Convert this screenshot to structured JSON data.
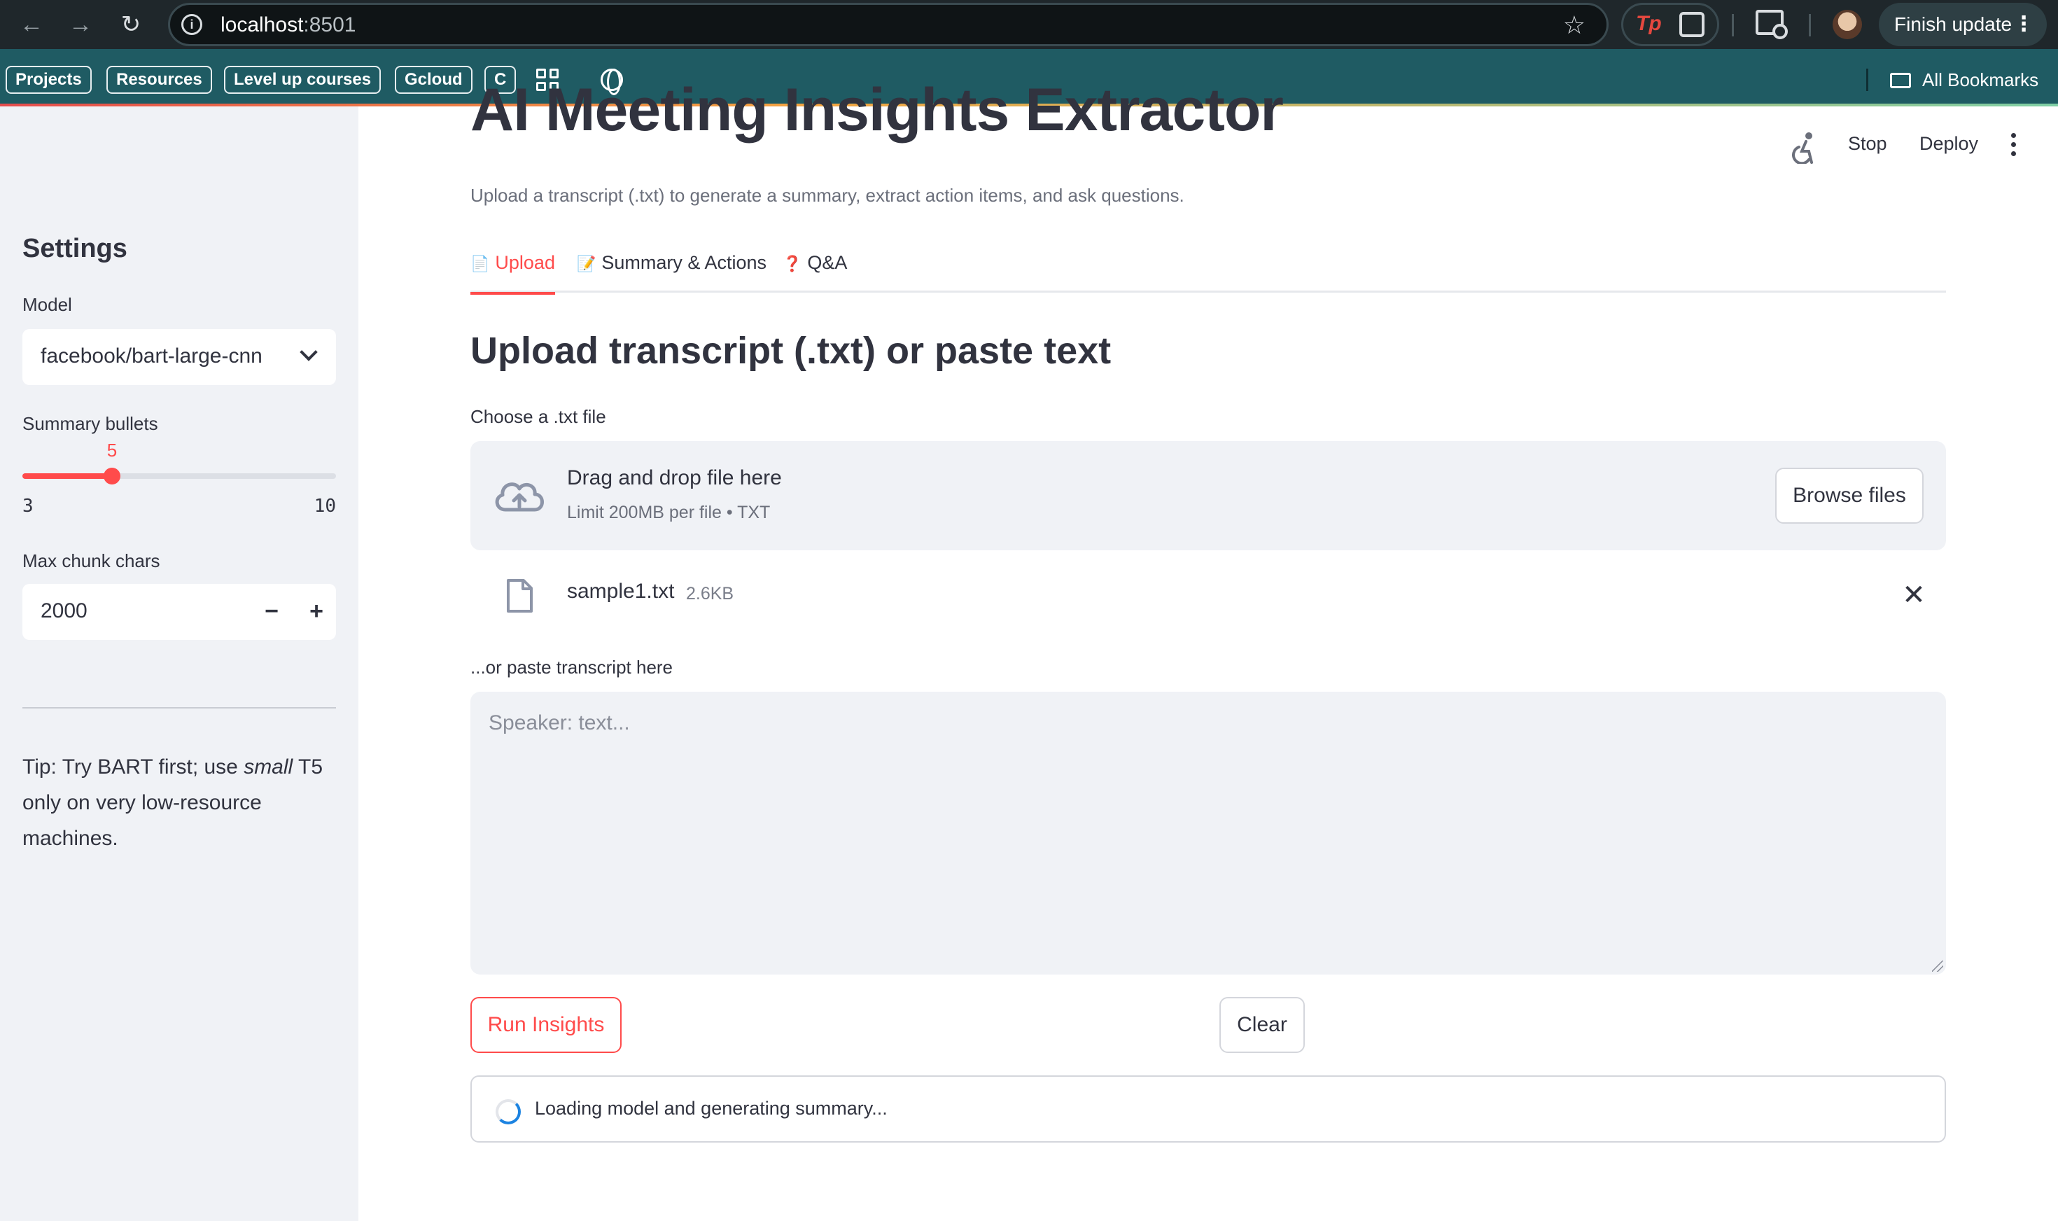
{
  "browser": {
    "url_host": "localhost",
    "url_port": ":8501",
    "finish_update": "Finish update",
    "bookmarks": [
      "Projects",
      "Resources",
      "Level up courses",
      "Gcloud",
      "C"
    ],
    "all_bookmarks": "All Bookmarks"
  },
  "app": {
    "title": "AI Meeting Insights Extractor",
    "subtitle": "Upload a transcript (.txt) to generate a summary, extract action items, and ask questions.",
    "stop_label": "Stop",
    "deploy_label": "Deploy"
  },
  "sidebar": {
    "title": "Settings",
    "model_label": "Model",
    "model_value": "facebook/bart-large-cnn",
    "bullets_label": "Summary bullets",
    "bullets_value": 5,
    "bullets_min": 3,
    "bullets_max": 10,
    "chunk_label": "Max chunk chars",
    "chunk_value": "2000",
    "tip_prefix": "Tip: Try BART first; use ",
    "tip_emphasis": "small",
    "tip_suffix": " T5 only on very low-resource machines."
  },
  "tabs": [
    {
      "icon": "📄",
      "label": "Upload",
      "active": true
    },
    {
      "icon": "📝",
      "label": "Summary & Actions",
      "active": false
    },
    {
      "icon": "❓",
      "label": "Q&A",
      "active": false
    }
  ],
  "upload": {
    "section_title": "Upload transcript (.txt) or paste text",
    "file_label": "Choose a .txt file",
    "drop_text": "Drag and drop file here",
    "limit_text": "Limit 200MB per file • TXT",
    "browse_label": "Browse files",
    "file_name": "sample1.txt",
    "file_size": "2.6KB",
    "paste_label": "...or paste transcript here",
    "paste_placeholder": "Speaker: text...",
    "run_label": "Run Insights",
    "clear_label": "Clear",
    "status_text": "Loading model and generating summary..."
  },
  "colors": {
    "accent": "#ff4b4b",
    "sidebar_bg": "#f0f2f6",
    "spinner": "#1c83e1"
  }
}
